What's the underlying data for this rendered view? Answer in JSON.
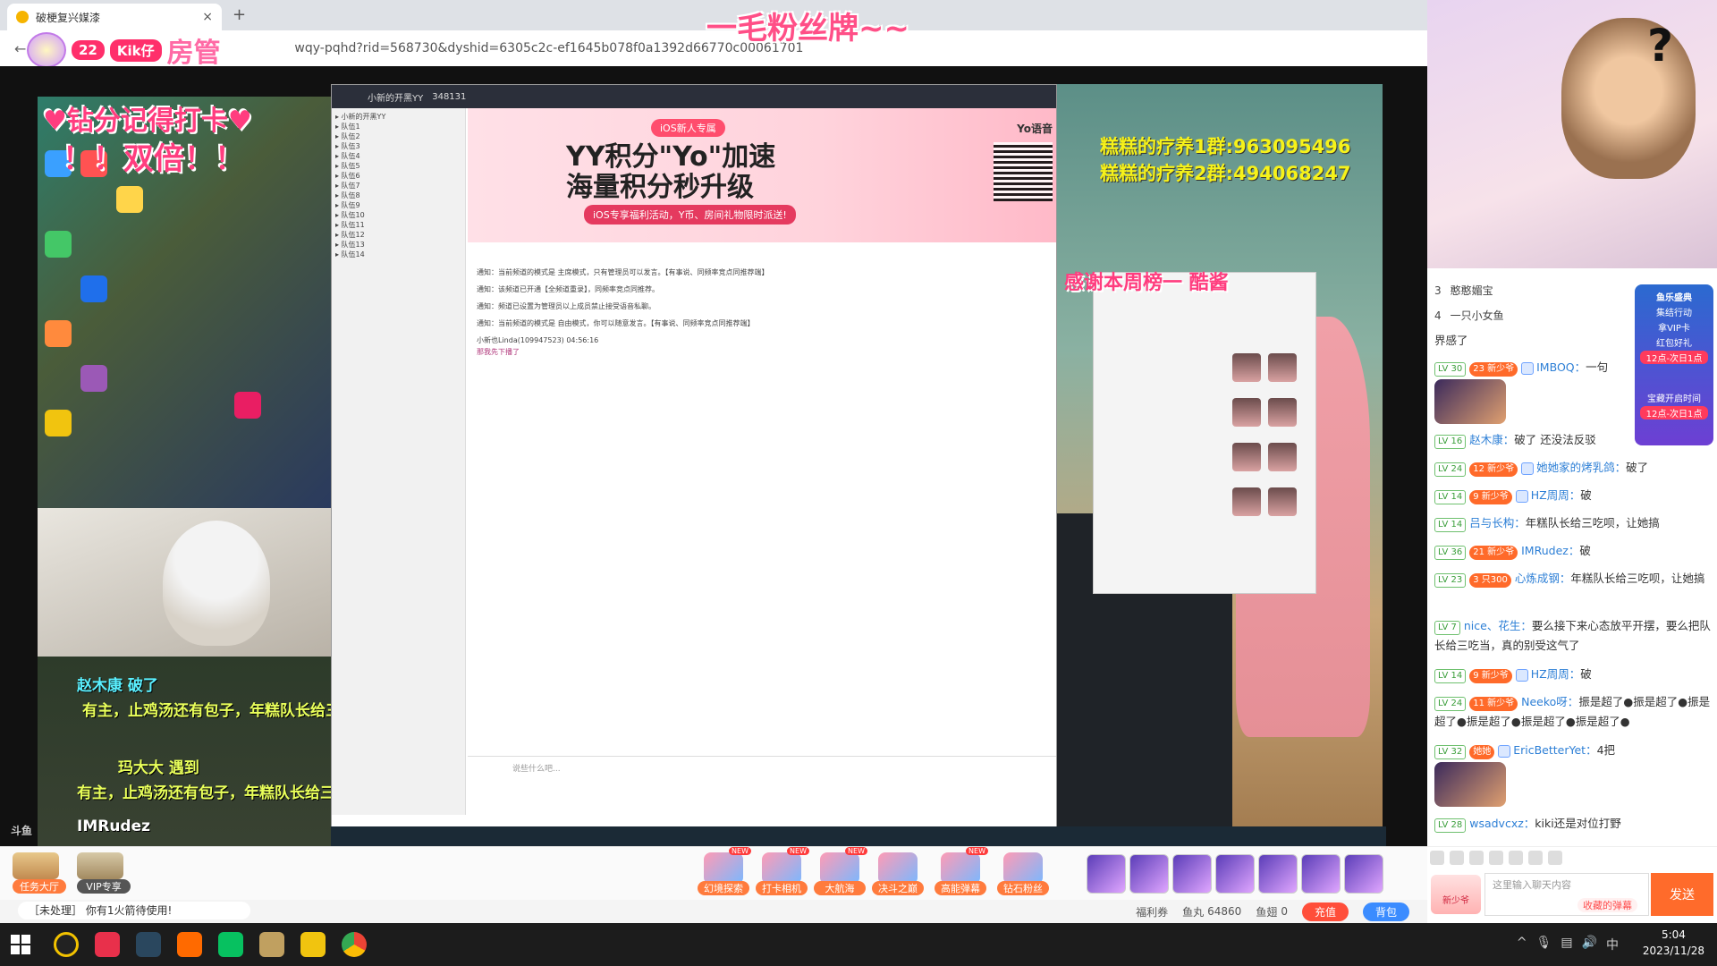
{
  "browser": {
    "tab_title": "破梗复兴媒漆",
    "url": "wqy-pqhd?rid=568730&dyshid=6305c2c-ef1645b078f0a1392d66770c00061701",
    "close_glyph": "×",
    "newtab_glyph": "+",
    "back_glyph": "←"
  },
  "overlay": {
    "title": "一毛粉丝牌~~",
    "manager_level": "22",
    "manager_name": "Kik仔",
    "manager_role": "房管",
    "checkin_text": "♥钻分记得打卡♥",
    "double_text": "！！双倍！！",
    "thanks_text": "感谢本周榜一 酷酱",
    "qq1": "糕糕的疗养1群:963095496",
    "qq2": "糕糕的疗养2群:494068247",
    "ov_line1": "赵木康 破了",
    "ov_line2": "有主，止鸡汤还有包子，年糕队长给三吃呗，让她搞",
    "ov_line3": "玛大大 遇到",
    "ov_line4": "有主，止鸡汤还有包子，年糕队长给三吃呗，让她搞",
    "ov_line5": "IMRudez",
    "ov_left_bottom": "斗鱼"
  },
  "yy": {
    "window_title": "小新的开黑YY",
    "room_id": "348131",
    "banner_tag": "iOS新人专属",
    "banner_title_1": "YY积分\"Yo\"加速",
    "banner_title_2": "海量积分秒升级",
    "banner_sub": "iOS专享福利活动，Y币、房间礼物限时派送!",
    "yo_label": "Yo语音",
    "chat": [
      "通知：当前频道的模式是 主席模式，只有管理员可以发言。【有事说、同频率竞点同推荐端】",
      "通知：该频道已开通【全频道重录】，同频率竞点同推荐。",
      "通知：频道已设置为管理员以上成员禁止接受语音私聊。",
      "通知：当前频道的模式是 自由模式，你可以随意发言。【有事说、同频率竞点同推荐端】",
      "小新也Linda(109947523) 04:56:16",
      "那我先下播了"
    ],
    "input_placeholder": "说些什么吧..."
  },
  "gifts": {
    "task_hall": "任务大厅",
    "vip": "VIP专享",
    "items": [
      {
        "label": "幻境探索",
        "new": "NEW"
      },
      {
        "label": "打卡相机",
        "new": "NEW"
      },
      {
        "label": "大航海",
        "new": "NEW"
      },
      {
        "label": "决斗之巅",
        "new": ""
      },
      {
        "label": "高能弹幕",
        "new": "NEW"
      },
      {
        "label": "钻石粉丝",
        "new": ""
      }
    ]
  },
  "footer": {
    "tip": "［未处理］ 你有1火箭待使用!",
    "welfare": "福利券",
    "yuwan_label": "鱼丸",
    "yuwan": "64860",
    "yuchi_label": "鱼翅",
    "yuchi": "0",
    "recharge": "充值",
    "backpack": "背包"
  },
  "right": {
    "rank": [
      {
        "no": "3",
        "name": "憨憨媚宝"
      },
      {
        "no": "4",
        "name": "一只小女鱼"
      }
    ],
    "event": {
      "title": "鱼乐盛典",
      "line1": "集结行动",
      "line2": "拿VIP卡",
      "line3": "红包好礼",
      "time1": "12点-次日1点",
      "line4": "宝藏开启时间",
      "time2": "12点-次日1点"
    },
    "chat": [
      {
        "lv": "",
        "fan": "",
        "name": "",
        "text": "界感了"
      },
      {
        "lv": "LV 30",
        "fan": "23 新少爷",
        "name": "IMBOQ：",
        "text": "一句"
      },
      {
        "lv": "LV 16",
        "fan": "",
        "name": "赵木康：",
        "text": "破了 还没法反驳"
      },
      {
        "lv": "LV 24",
        "fan": "12 新少爷",
        "name": "她她家的烤乳鸽：",
        "text": "破了"
      },
      {
        "lv": "LV 14",
        "fan": "9 新少爷",
        "name": "HZ周周：",
        "text": "破"
      },
      {
        "lv": "LV 14",
        "fan": "",
        "name": "吕与长构：",
        "text": "年糕队长给三吃呗，让她搞"
      },
      {
        "lv": "LV 36",
        "fan": "21 新少爷",
        "name": "IMRudez：",
        "text": "破"
      },
      {
        "lv": "LV 23",
        "fan": "3 只300",
        "name": "心炼成钢：",
        "text": "年糕队长给三吃呗，让她搞"
      },
      {
        "lv": "LV 7",
        "fan": "",
        "name": "nice、花生：",
        "text": "要么接下来心态放平开摆，要么把队长给三吃当，真的别受这气了"
      },
      {
        "lv": "LV 14",
        "fan": "9 新少爷",
        "name": "HZ周周：",
        "text": "破"
      },
      {
        "lv": "LV 24",
        "fan": "11 新少爷",
        "name": "Neeko呀：",
        "text": "振是超了●振是超了●振是超了●振是超了●振是超了●振是超了●"
      },
      {
        "lv": "LV 32",
        "fan": "她她",
        "name": "EricBetterYet：",
        "text": "4把"
      },
      {
        "lv": "LV 28",
        "fan": "",
        "name": "wsadvcxz：",
        "text": "kiki还是对位打野"
      }
    ],
    "newbie": "新少爷",
    "input_placeholder": "这里输入聊天内容",
    "collect": "收藏的弹幕",
    "send": "发送"
  },
  "taskbar": {
    "time": "5:04",
    "date": "2023/11/28",
    "ime": "中"
  }
}
